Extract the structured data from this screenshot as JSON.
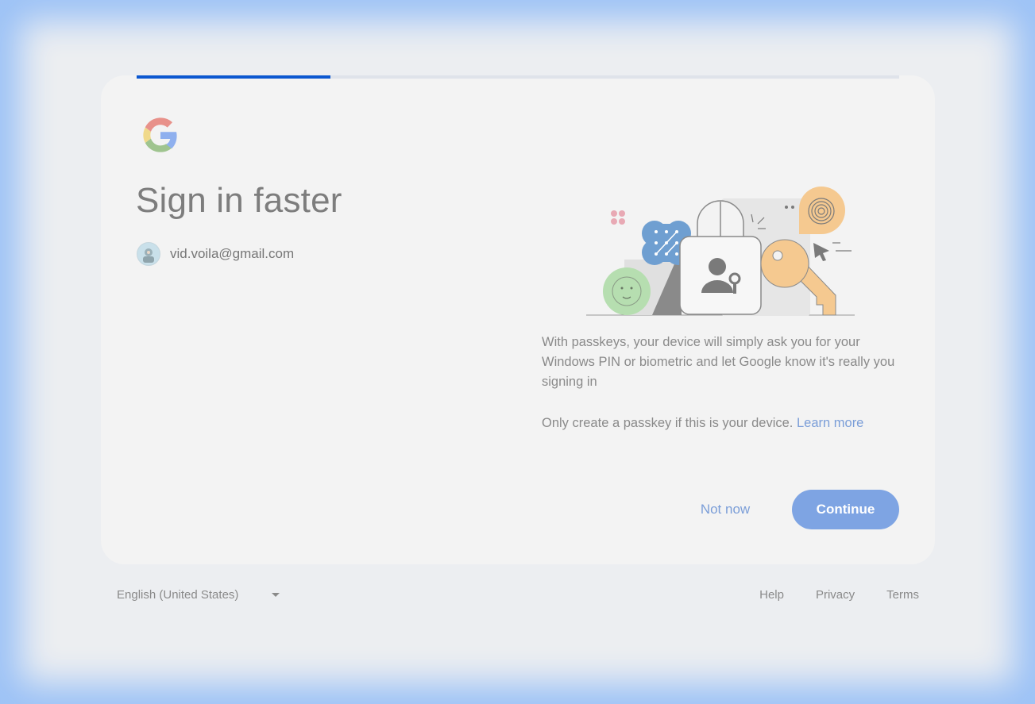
{
  "progress": {
    "fraction": 0.254
  },
  "header": {
    "title": "Sign in faster",
    "account_email": "vid.voila@gmail.com"
  },
  "main": {
    "description": "With passkeys, your device will simply ask you for your Windows PIN or biometric and let Google know it's really you signing in",
    "note": "Only create a passkey if this is your device.",
    "learn_more": "Learn more"
  },
  "actions": {
    "secondary_label": "Not now",
    "primary_label": "Continue"
  },
  "footer": {
    "language": "English (United States)",
    "links": {
      "help": "Help",
      "privacy": "Privacy",
      "terms": "Terms"
    }
  },
  "colors": {
    "accent": "#0b57d0",
    "button": "#7ea4e3",
    "link": "#7b9ed8",
    "background_glow": "#9cc2f6"
  },
  "icons": [
    "google-logo",
    "avatar",
    "passkey-illustration",
    "chevron-down-icon"
  ]
}
